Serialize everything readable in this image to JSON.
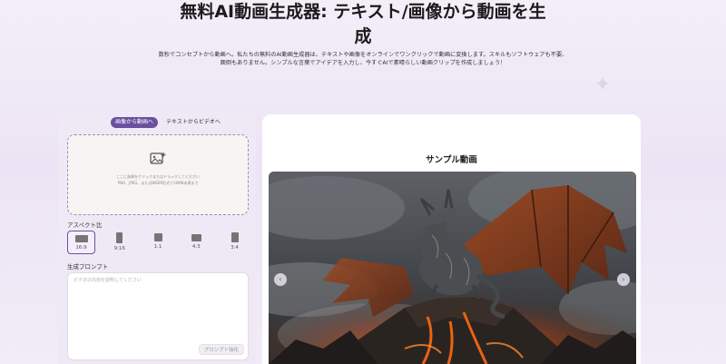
{
  "hero": {
    "title_line1": "無料AI動画生成器: テキスト/画像から動画を生",
    "title_line2": "成",
    "subtitle_line1": "数秒でコンセプトから動画へ。私たちの無料のAI動画生成器は、テキストや画像をオンラインでワンクリックで動画に変換します。スキルもソフトウェアも不要、",
    "subtitle_line2": "面倒もありません。シンプルな言葉でアイデアを入力し、今すぐAIで素晴らしい動画クリップを作成しましょう！"
  },
  "mode_tabs": [
    {
      "label": "画像から動画へ",
      "active": true
    },
    {
      "label": "テキストからビデオへ",
      "active": false
    }
  ],
  "upload": {
    "icon": "image-upload-icon",
    "hint_line1": "ここに画像をクリックまたはドラッグしてください",
    "hint_line2": "PNG、JPEG、またはWEBP形式で10MB未満まで"
  },
  "aspect": {
    "label": "アスペクト比",
    "options": [
      {
        "name": "16:9",
        "selected": true
      },
      {
        "name": "9:16",
        "selected": false
      },
      {
        "name": "1:1",
        "selected": false
      },
      {
        "name": "4:3",
        "selected": false
      },
      {
        "name": "3:4",
        "selected": false
      }
    ]
  },
  "prompt": {
    "label": "生成プロンプト",
    "placeholder": "ビデオの内容を説明してください",
    "optimize_label": "プロンプト強化"
  },
  "sample": {
    "title": "サンプル動画",
    "prev_icon": "chevron-left-icon",
    "next_icon": "chevron-right-icon"
  },
  "colors": {
    "accent": "#6b4fa0",
    "background": "#efe9f5"
  }
}
